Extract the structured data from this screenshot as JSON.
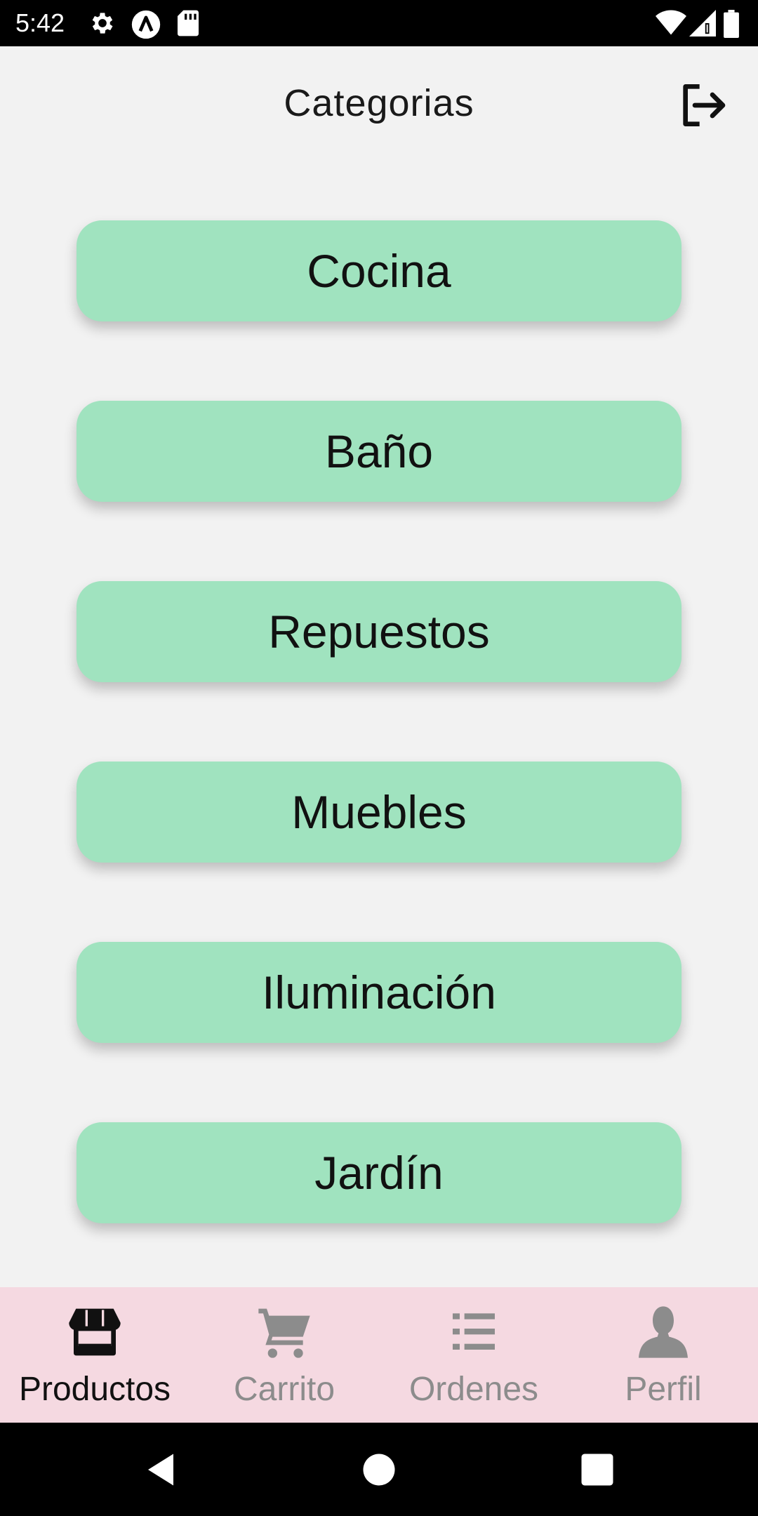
{
  "status_bar": {
    "time": "5:42",
    "icons": [
      "settings-gear-icon",
      "a-circle-icon",
      "sd-card-icon",
      "wifi-icon",
      "signal-icon",
      "battery-icon"
    ]
  },
  "header": {
    "title": "Categorias",
    "logout_icon": "logout-icon"
  },
  "categories": [
    {
      "label": "Cocina"
    },
    {
      "label": "Baño"
    },
    {
      "label": "Repuestos"
    },
    {
      "label": "Muebles"
    },
    {
      "label": "Iluminación"
    },
    {
      "label": "Jardín"
    }
  ],
  "bottom_nav": {
    "items": [
      {
        "label": "Productos",
        "icon": "store-icon",
        "active": true
      },
      {
        "label": "Carrito",
        "icon": "cart-icon",
        "active": false
      },
      {
        "label": "Ordenes",
        "icon": "list-icon",
        "active": false
      },
      {
        "label": "Perfil",
        "icon": "person-icon",
        "active": false
      }
    ]
  },
  "system_nav": {
    "icons": [
      "back-icon",
      "home-icon",
      "recents-icon"
    ]
  },
  "colors": {
    "background": "#f2f2f2",
    "category_button": "#a0e3bf",
    "bottom_nav_background": "#f5d9e1",
    "nav_active": "#111111",
    "nav_inactive": "#8c8c8c"
  }
}
